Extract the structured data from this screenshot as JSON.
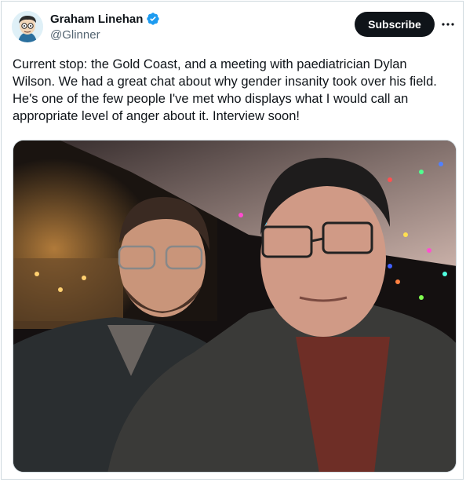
{
  "author": {
    "name": "Graham Linehan",
    "handle": "@Glinner",
    "verified": true
  },
  "actions": {
    "subscribe_label": "Subscribe",
    "more_icon": "more-horizontal-icon"
  },
  "tweet": {
    "text": "Current stop: the Gold Coast, and a meeting with paediatrician Dylan Wilson. We had a great chat about why gender insanity took over his field. He's one of the few people I've met who displays what I would call an appropriate level of anger about it. Interview soon!"
  },
  "colors": {
    "verified_blue": "#1d9bf0",
    "subscribe_bg": "#0f1419",
    "handle_gray": "#536471",
    "border": "#cfd9de"
  }
}
